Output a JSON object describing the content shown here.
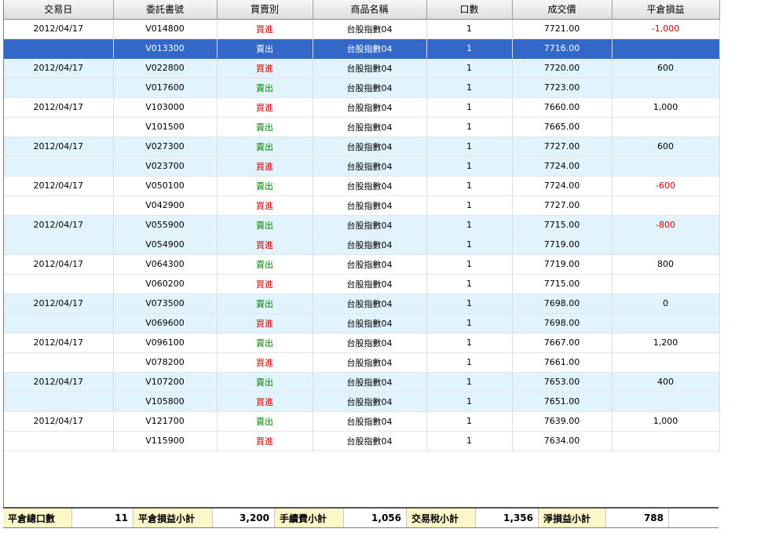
{
  "table": {
    "headers": [
      "交易日",
      "委託書號",
      "買賣別",
      "商品名稱",
      "口數",
      "成交價",
      "平倉損益"
    ],
    "rows": [
      {
        "date": "2012/04/17",
        "order": "V014800",
        "side": "買進",
        "product": "台股指數04",
        "qty": "1",
        "price": "7721.00",
        "pnl": "-1,000"
      },
      {
        "date": "",
        "order": "V013300",
        "side": "賣出",
        "product": "台股指數04",
        "qty": "1",
        "price": "7716.00",
        "pnl": ""
      },
      {
        "date": "2012/04/17",
        "order": "V022800",
        "side": "買進",
        "product": "台股指數04",
        "qty": "1",
        "price": "7720.00",
        "pnl": "600"
      },
      {
        "date": "",
        "order": "V017600",
        "side": "賣出",
        "product": "台股指數04",
        "qty": "1",
        "price": "7723.00",
        "pnl": ""
      },
      {
        "date": "2012/04/17",
        "order": "V103000",
        "side": "買進",
        "product": "台股指數04",
        "qty": "1",
        "price": "7660.00",
        "pnl": "1,000"
      },
      {
        "date": "",
        "order": "V101500",
        "side": "賣出",
        "product": "台股指數04",
        "qty": "1",
        "price": "7665.00",
        "pnl": ""
      },
      {
        "date": "2012/04/17",
        "order": "V027300",
        "side": "賣出",
        "product": "台股指數04",
        "qty": "1",
        "price": "7727.00",
        "pnl": "600"
      },
      {
        "date": "",
        "order": "V023700",
        "side": "買進",
        "product": "台股指數04",
        "qty": "1",
        "price": "7724.00",
        "pnl": ""
      },
      {
        "date": "2012/04/17",
        "order": "V050100",
        "side": "賣出",
        "product": "台股指數04",
        "qty": "1",
        "price": "7724.00",
        "pnl": "-600"
      },
      {
        "date": "",
        "order": "V042900",
        "side": "買進",
        "product": "台股指數04",
        "qty": "1",
        "price": "7727.00",
        "pnl": ""
      },
      {
        "date": "2012/04/17",
        "order": "V055900",
        "side": "賣出",
        "product": "台股指數04",
        "qty": "1",
        "price": "7715.00",
        "pnl": "-800"
      },
      {
        "date": "",
        "order": "V054900",
        "side": "買進",
        "product": "台股指數04",
        "qty": "1",
        "price": "7719.00",
        "pnl": ""
      },
      {
        "date": "2012/04/17",
        "order": "V064300",
        "side": "賣出",
        "product": "台股指數04",
        "qty": "1",
        "price": "7719.00",
        "pnl": "800"
      },
      {
        "date": "",
        "order": "V060200",
        "side": "買進",
        "product": "台股指數04",
        "qty": "1",
        "price": "7715.00",
        "pnl": ""
      },
      {
        "date": "2012/04/17",
        "order": "V073500",
        "side": "賣出",
        "product": "台股指數04",
        "qty": "1",
        "price": "7698.00",
        "pnl": "0"
      },
      {
        "date": "",
        "order": "V069600",
        "side": "買進",
        "product": "台股指數04",
        "qty": "1",
        "price": "7698.00",
        "pnl": ""
      },
      {
        "date": "2012/04/17",
        "order": "V096100",
        "side": "賣出",
        "product": "台股指數04",
        "qty": "1",
        "price": "7667.00",
        "pnl": "1,200"
      },
      {
        "date": "",
        "order": "V078200",
        "side": "買進",
        "product": "台股指數04",
        "qty": "1",
        "price": "7661.00",
        "pnl": ""
      },
      {
        "date": "2012/04/17",
        "order": "V107200",
        "side": "賣出",
        "product": "台股指數04",
        "qty": "1",
        "price": "7653.00",
        "pnl": "400"
      },
      {
        "date": "",
        "order": "V105800",
        "side": "買進",
        "product": "台股指數04",
        "qty": "1",
        "price": "7651.00",
        "pnl": ""
      },
      {
        "date": "2012/04/17",
        "order": "V121700",
        "side": "賣出",
        "product": "台股指數04",
        "qty": "1",
        "price": "7639.00",
        "pnl": "1,000"
      },
      {
        "date": "",
        "order": "V115900",
        "side": "買進",
        "product": "台股指數04",
        "qty": "1",
        "price": "7634.00",
        "pnl": ""
      }
    ],
    "selected_row": 1
  },
  "summary": {
    "total_lots_label": "平倉總口數",
    "total_lots": "11",
    "pnl_subtotal_label": "平倉損益小計",
    "pnl_subtotal": "3,200",
    "fee_subtotal_label": "手續費小計",
    "fee_subtotal": "1,056",
    "tax_subtotal_label": "交易稅小計",
    "tax_subtotal": "1,356",
    "net_pnl_label": "淨損益小計",
    "net_pnl": "788"
  },
  "colors": {
    "buy": "#cc0000",
    "sell": "#008800",
    "negative": "#cc0000",
    "selection": "#3468c8",
    "band": "#e1f3fc",
    "summary_label_bg": "#fdf6c8"
  }
}
